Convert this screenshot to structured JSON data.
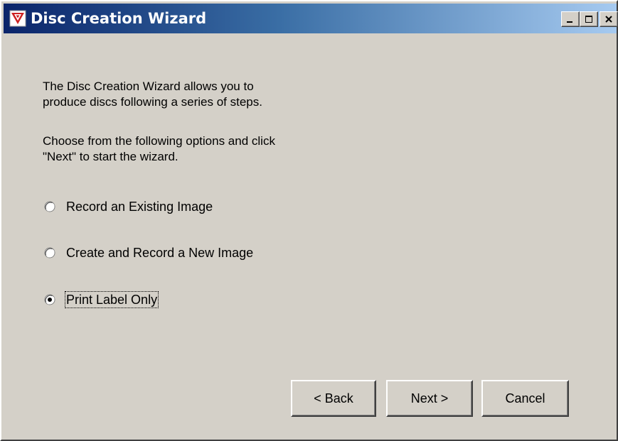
{
  "window": {
    "title": "Disc Creation Wizard",
    "icon": "disc-wizard-icon",
    "caption_buttons": {
      "minimize": "minimize-icon",
      "maximize": "maximize-icon",
      "close": "close-icon"
    }
  },
  "intro": {
    "line1": "The Disc Creation Wizard allows you to",
    "line2": "produce discs following a series of steps."
  },
  "instructions": {
    "line1": "Choose from the following options and click",
    "line2": "\"Next\" to start the wizard."
  },
  "options": [
    {
      "label": "Record an Existing Image",
      "selected": false
    },
    {
      "label": "Create and Record a New Image",
      "selected": false
    },
    {
      "label": "Print Label Only",
      "selected": true
    }
  ],
  "buttons": {
    "back": "< Back",
    "next": "Next >",
    "cancel": "Cancel"
  },
  "colors": {
    "titlebar_start": "#0a246a",
    "titlebar_end": "#a6caf0",
    "face": "#d4d0c8",
    "icon_accent": "#cc2222"
  }
}
